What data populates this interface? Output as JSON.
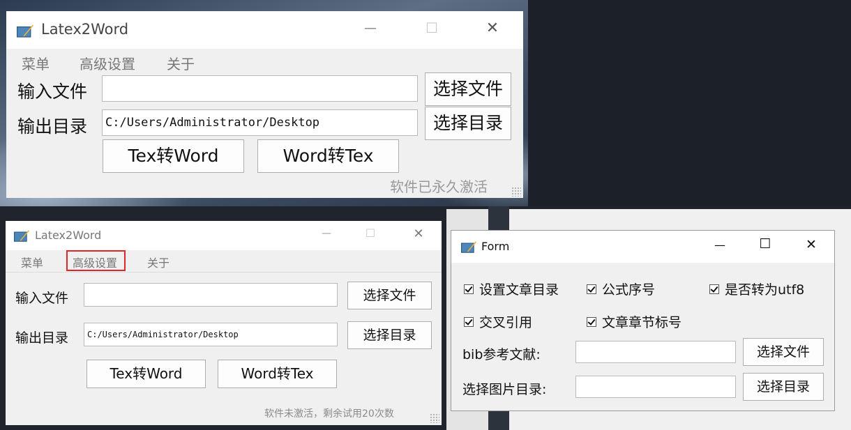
{
  "top_window": {
    "title": "Latex2Word",
    "menu": [
      "菜单",
      "高级设置",
      "关于"
    ],
    "input_file_label": "输入文件",
    "input_file_value": "",
    "select_file_button": "选择文件",
    "output_dir_label": "输出目录",
    "output_dir_value": "C:/Users/Administrator/Desktop",
    "select_dir_button": "选择目录",
    "tex_to_word_button": "Tex转Word",
    "word_to_tex_button": "Word转Tex",
    "status": "软件已永久激活"
  },
  "bottom_window": {
    "title": "Latex2Word",
    "menu": [
      "菜单",
      "高级设置",
      "关于"
    ],
    "highlighted_menu": "高级设置",
    "highlight_color": "#e0252b",
    "input_file_label": "输入文件",
    "input_file_value": "",
    "select_file_button": "选择文件",
    "output_dir_label": "输出目录",
    "output_dir_value": "C:/Users/Administrator/Desktop",
    "select_dir_button": "选择目录",
    "tex_to_word_button": "Tex转Word",
    "word_to_tex_button": "Word转Tex",
    "status": "软件未激活，剩余试用20次数"
  },
  "form_window": {
    "title": "Form",
    "checkboxes": [
      {
        "label": "设置文章目录",
        "checked": true
      },
      {
        "label": "公式序号",
        "checked": true
      },
      {
        "label": "是否转为utf8",
        "checked": true
      },
      {
        "label": "交叉引用",
        "checked": true
      },
      {
        "label": "文章章节标号",
        "checked": true
      }
    ],
    "bib_label": "bib参考文献:",
    "bib_value": "",
    "bib_button": "选择文件",
    "image_dir_label": "选择图片目录:",
    "image_dir_value": "",
    "image_dir_button": "选择目录"
  },
  "icons": {
    "app_icon": "book-quill-icon",
    "minimize": "minimize-icon",
    "maximize": "maximize-icon",
    "close": "close-icon"
  },
  "window_controls": {
    "minimize_glyph": "—",
    "maximize_glyph": "☐",
    "close_glyph": "✕"
  }
}
